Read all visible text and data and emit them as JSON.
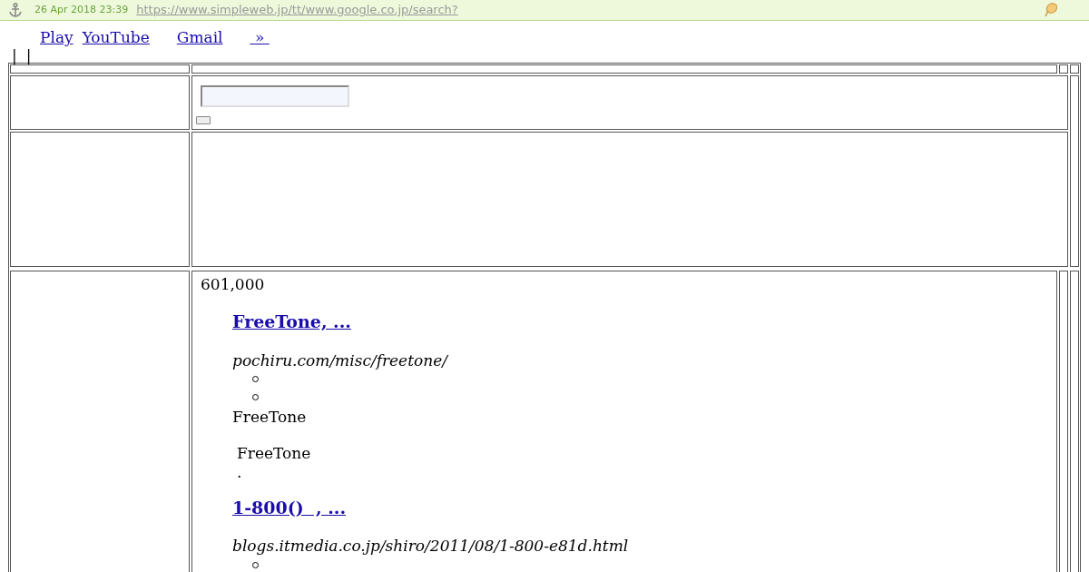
{
  "archive_bar": {
    "date": "26 Apr 2018 23:39",
    "url": "https://www.simpleweb.jp/tt/www.google.co.jp/search?"
  },
  "nav_links": [
    {
      "label": "Play"
    },
    {
      "label": "YouTube"
    },
    {
      "label": "Gmail"
    },
    {
      "label": "»"
    }
  ],
  "separators": [
    "|",
    "|"
  ],
  "results": {
    "count": "601,000",
    "items": [
      {
        "title": "FreeTone, ...",
        "url": "pochiru.com/misc/freetone/",
        "sub_items": [
          {
            "kind": "bullet"
          },
          {
            "kind": "bullet"
          }
        ],
        "snippets": [
          "FreeTone",
          "FreeTone",
          "."
        ]
      },
      {
        "title": "1-800()  , ...",
        "url": "blogs.itmedia.co.jp/shiro/2011/08/1-800-e81d.html",
        "sub_items": [
          {
            "kind": "bullet"
          }
        ]
      }
    ]
  }
}
